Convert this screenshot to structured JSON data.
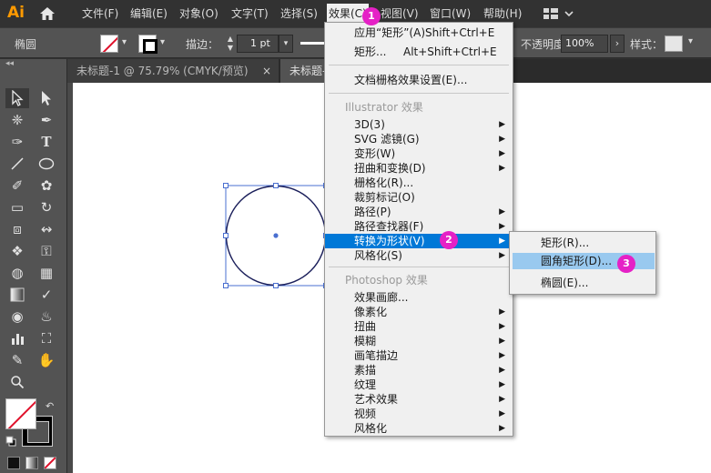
{
  "app": {
    "logo_text": "Ai"
  },
  "menubar": {
    "file": "文件(F)",
    "edit": "编辑(E)",
    "object": "对象(O)",
    "type": "文字(T)",
    "select": "选择(S)",
    "effect": "效果(C)",
    "view": "视图(V)",
    "window": "窗口(W)",
    "help": "帮助(H)"
  },
  "control": {
    "object_label": "椭圆",
    "stroke_label": "描边：",
    "stroke_weight": "1 pt",
    "opacity_label": "不透明度：",
    "opacity_value": "100%",
    "style_label": "样式："
  },
  "tabs": [
    {
      "label": "未标题-1 @ 75.79% (CMYK/预览)",
      "close": "×"
    },
    {
      "label": "未标题-"
    }
  ],
  "effect_menu": {
    "apply_last": "应用“矩形”(A)",
    "apply_last_shortcut": "Shift+Ctrl+E",
    "last_effect": "矩形...",
    "last_effect_shortcut": "Alt+Shift+Ctrl+E",
    "document_raster": "文档栅格效果设置(E)...",
    "illustrator_header": "Illustrator 效果",
    "illustrator_items": [
      "3D(3)",
      "SVG 滤镜(G)",
      "变形(W)",
      "扭曲和变换(D)",
      "栅格化(R)...",
      "裁剪标记(O)",
      "路径(P)",
      "路径查找器(F)",
      "转换为形状(V)",
      "风格化(S)"
    ],
    "photoshop_header": "Photoshop 效果",
    "photoshop_items": [
      "效果画廊...",
      "像素化",
      "扭曲",
      "模糊",
      "画笔描边",
      "素描",
      "纹理",
      "艺术效果",
      "视频",
      "风格化"
    ]
  },
  "convert_submenu": {
    "items": [
      "矩形(R)...",
      "圆角矩形(D)...",
      "椭圆(E)..."
    ]
  },
  "badges": [
    "1",
    "2",
    "3"
  ],
  "colors": {
    "badge": "#e521c6",
    "menu_highlight": "#0078d7",
    "submenu_highlight": "#99c9ef",
    "selection": "#4a6fd0",
    "logo": "#ff9a00"
  }
}
